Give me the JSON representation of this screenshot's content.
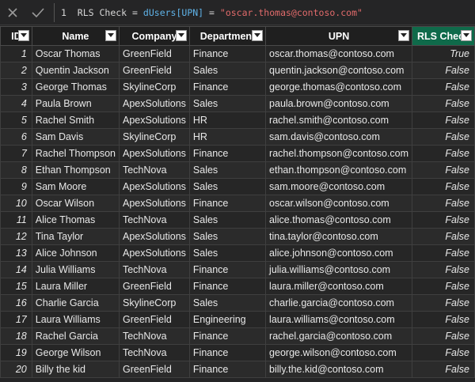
{
  "formula": {
    "line_number": "1",
    "lhs": "RLS Check",
    "operator1": "=",
    "func": "dUsers",
    "bracket_field": "[UPN]",
    "operator2": "=",
    "string_literal": "\"oscar.thomas@contoso.com\"",
    "cancel_icon": "close-icon",
    "commit_icon": "check-icon"
  },
  "columns": [
    {
      "key": "id",
      "label": "ID"
    },
    {
      "key": "name",
      "label": "Name"
    },
    {
      "key": "company",
      "label": "Company"
    },
    {
      "key": "department",
      "label": "Department"
    },
    {
      "key": "upn",
      "label": "UPN"
    },
    {
      "key": "rls",
      "label": "RLS Check",
      "active": true
    }
  ],
  "rows": [
    {
      "id": "1",
      "name": "Oscar Thomas",
      "company": "GreenField",
      "department": "Finance",
      "upn": "oscar.thomas@contoso.com",
      "rls": "True"
    },
    {
      "id": "2",
      "name": "Quentin Jackson",
      "company": "GreenField",
      "department": "Sales",
      "upn": "quentin.jackson@contoso.com",
      "rls": "False"
    },
    {
      "id": "3",
      "name": "George Thomas",
      "company": "SkylineCorp",
      "department": "Finance",
      "upn": "george.thomas@contoso.com",
      "rls": "False"
    },
    {
      "id": "4",
      "name": "Paula Brown",
      "company": "ApexSolutions",
      "department": "Sales",
      "upn": "paula.brown@contoso.com",
      "rls": "False"
    },
    {
      "id": "5",
      "name": "Rachel Smith",
      "company": "ApexSolutions",
      "department": "HR",
      "upn": "rachel.smith@contoso.com",
      "rls": "False"
    },
    {
      "id": "6",
      "name": "Sam Davis",
      "company": "SkylineCorp",
      "department": "HR",
      "upn": "sam.davis@contoso.com",
      "rls": "False"
    },
    {
      "id": "7",
      "name": "Rachel Thompson",
      "company": "ApexSolutions",
      "department": "Finance",
      "upn": "rachel.thompson@contoso.com",
      "rls": "False"
    },
    {
      "id": "8",
      "name": "Ethan Thompson",
      "company": "TechNova",
      "department": "Sales",
      "upn": "ethan.thompson@contoso.com",
      "rls": "False"
    },
    {
      "id": "9",
      "name": "Sam Moore",
      "company": "ApexSolutions",
      "department": "Sales",
      "upn": "sam.moore@contoso.com",
      "rls": "False"
    },
    {
      "id": "10",
      "name": "Oscar Wilson",
      "company": "ApexSolutions",
      "department": "Finance",
      "upn": "oscar.wilson@contoso.com",
      "rls": "False"
    },
    {
      "id": "11",
      "name": "Alice Thomas",
      "company": "TechNova",
      "department": "Sales",
      "upn": "alice.thomas@contoso.com",
      "rls": "False"
    },
    {
      "id": "12",
      "name": "Tina Taylor",
      "company": "ApexSolutions",
      "department": "Sales",
      "upn": "tina.taylor@contoso.com",
      "rls": "False"
    },
    {
      "id": "13",
      "name": "Alice Johnson",
      "company": "ApexSolutions",
      "department": "Sales",
      "upn": "alice.johnson@contoso.com",
      "rls": "False"
    },
    {
      "id": "14",
      "name": "Julia Williams",
      "company": "TechNova",
      "department": "Finance",
      "upn": "julia.williams@contoso.com",
      "rls": "False"
    },
    {
      "id": "15",
      "name": "Laura Miller",
      "company": "GreenField",
      "department": "Finance",
      "upn": "laura.miller@contoso.com",
      "rls": "False"
    },
    {
      "id": "16",
      "name": "Charlie Garcia",
      "company": "SkylineCorp",
      "department": "Sales",
      "upn": "charlie.garcia@contoso.com",
      "rls": "False"
    },
    {
      "id": "17",
      "name": "Laura Williams",
      "company": "GreenField",
      "department": "Engineering",
      "upn": "laura.williams@contoso.com",
      "rls": "False"
    },
    {
      "id": "18",
      "name": "Rachel Garcia",
      "company": "TechNova",
      "department": "Finance",
      "upn": "rachel.garcia@contoso.com",
      "rls": "False"
    },
    {
      "id": "19",
      "name": "George Wilson",
      "company": "TechNova",
      "department": "Finance",
      "upn": "george.wilson@contoso.com",
      "rls": "False"
    },
    {
      "id": "20",
      "name": "Billy the kid",
      "company": "GreenField",
      "department": "Finance",
      "upn": "billy.the.kid@contoso.com",
      "rls": "False"
    }
  ],
  "filter_icon": "chevron-down-icon",
  "colors": {
    "background": "#252526",
    "active_header": "#0f6a4a",
    "formula_function": "#5fb3e8",
    "formula_string": "#e26b6b"
  }
}
